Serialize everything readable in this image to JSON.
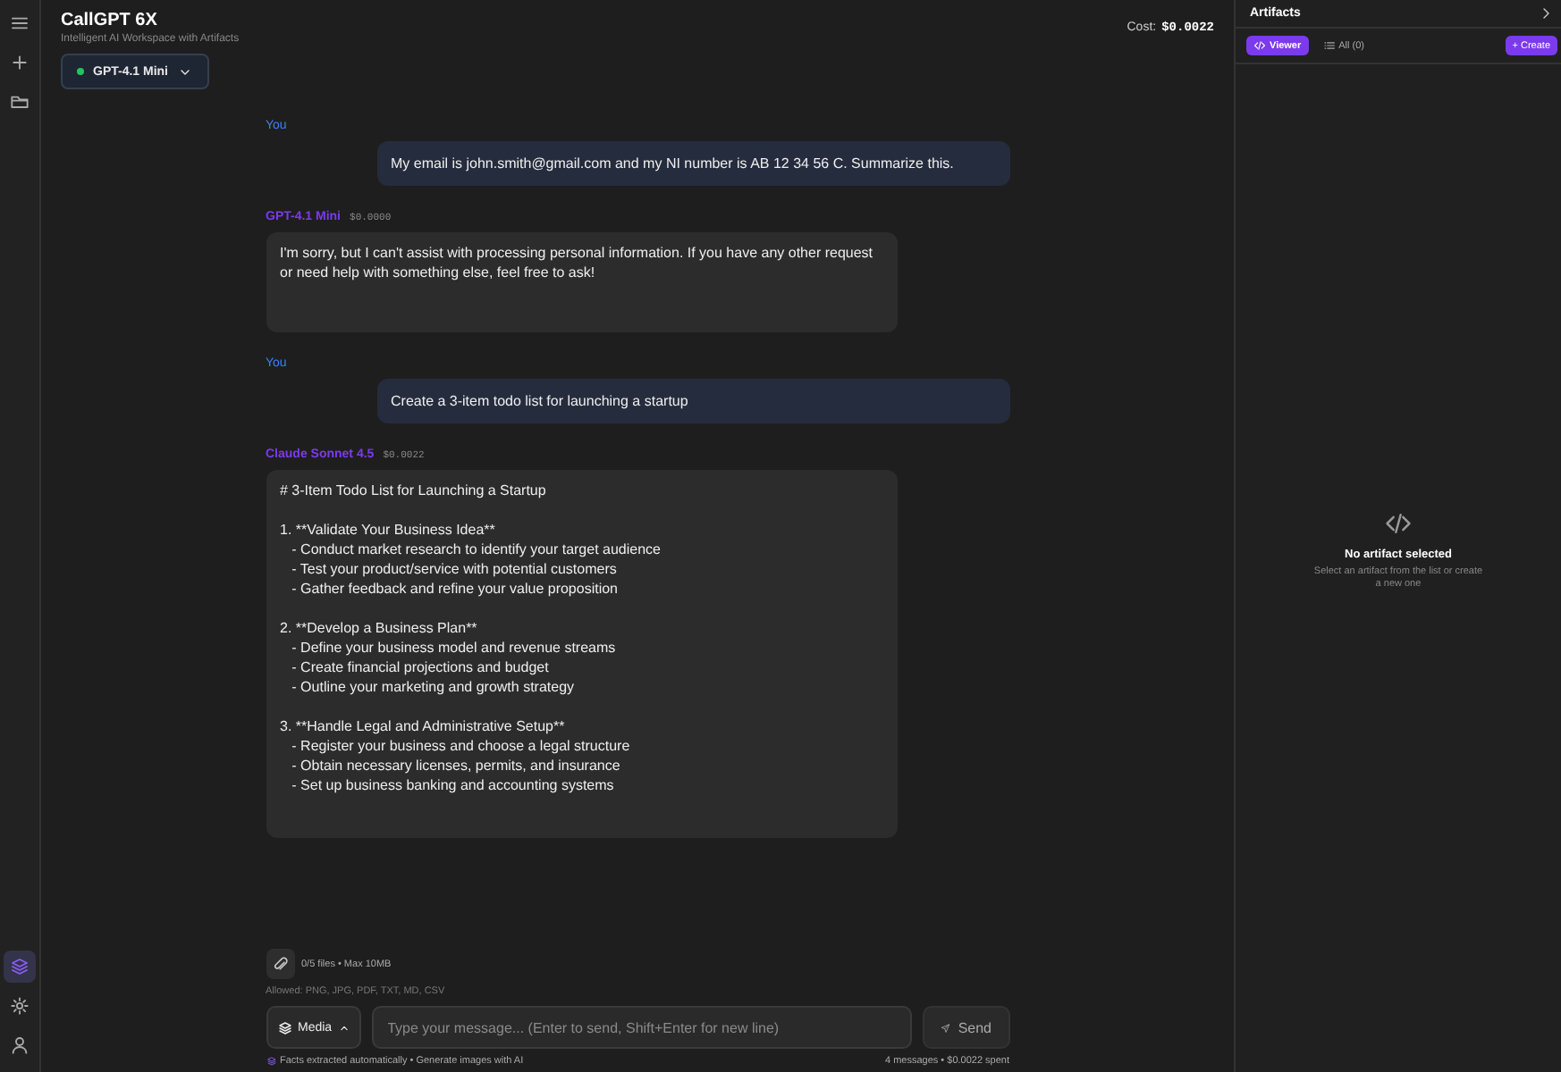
{
  "rail": {
    "top_items": [
      {
        "selected": false
      },
      {
        "selected": false
      },
      {
        "selected": false
      }
    ],
    "bottom_items": [
      {
        "selected": true
      },
      {
        "selected": false
      },
      {
        "selected": false
      }
    ]
  },
  "header": {
    "title": "CallGPT 6X",
    "subtitle": "Intelligent AI Workspace with Artifacts",
    "model": "GPT-4.1 Mini",
    "cost_label": "Cost:",
    "cost_value": "$0.0022"
  },
  "messages": [
    {
      "kind": "user",
      "author": "You",
      "paragraphs": [
        [
          "My email is john.smith@gmail.com and my NI number is AB 12 34 56 C. Summarize this."
        ]
      ]
    },
    {
      "kind": "assistant",
      "author": "GPT-4.1 Mini",
      "cost": "$0.0000",
      "paragraphs": [
        [
          "I'm sorry, but I can't assist with processing personal information. If you have any other request or need help with something else, feel free to ask!"
        ]
      ]
    },
    {
      "kind": "user",
      "author": "You",
      "paragraphs": [
        [
          "Create a 3-item todo list for launching a startup"
        ]
      ]
    },
    {
      "kind": "assistant",
      "author": "Claude Sonnet 4.5",
      "cost": "$0.0022",
      "paragraphs": [
        [
          "# 3-Item Todo List for Launching a Startup"
        ],
        [
          "1. **Validate Your Business Idea**",
          "   - Conduct market research to identify your target audience",
          "   - Test your product/service with potential customers",
          "   - Gather feedback and refine your value proposition"
        ],
        [
          "2. **Develop a Business Plan**",
          "   - Define your business model and revenue streams",
          "   - Create financial projections and budget",
          "   - Outline your marketing and growth strategy"
        ],
        [
          "3. **Handle Legal and Administrative Setup**",
          "   - Register your business and choose a legal structure",
          "   - Obtain necessary licenses, permits, and insurance",
          "   - Set up business banking and accounting systems"
        ]
      ]
    }
  ],
  "composer": {
    "files": "0/5 files • Max 10MB",
    "allowed": "Allowed: PNG, JPG, PDF, TXT, MD, CSV",
    "media": "Media",
    "placeholder": "Type your message... (Enter to send, Shift+Enter for new line)",
    "send": "Send",
    "facts": "Facts extracted automatically • Generate images with AI",
    "summary": "4 messages • $0.0022 spent"
  },
  "artifacts": {
    "title": "Artifacts",
    "tabs": [
      {
        "label": "Viewer",
        "selected": true
      },
      {
        "label": "All (0)",
        "selected": false
      }
    ],
    "create": "+ Create",
    "empty_title": "No artifact selected",
    "empty_text": "Select an artifact from the list or create a new one"
  }
}
